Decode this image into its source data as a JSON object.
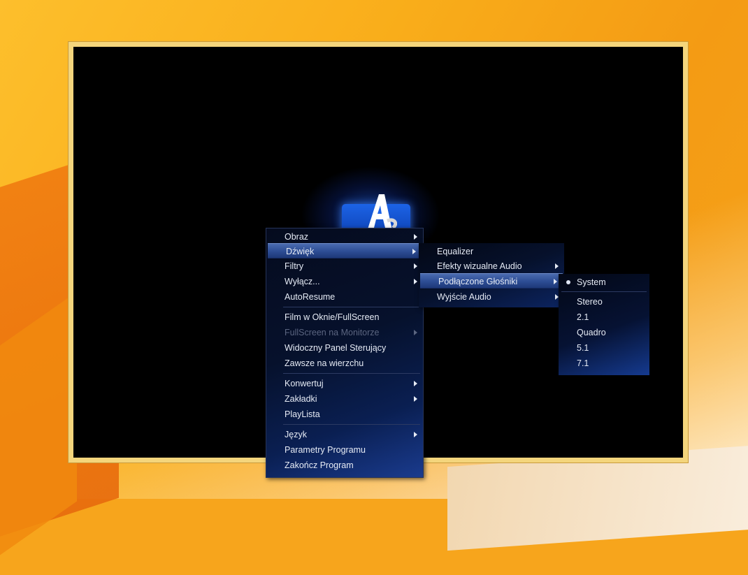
{
  "main_menu": {
    "items": [
      {
        "label": "Obraz",
        "submenu": true,
        "disabled": false,
        "highlighted": false
      },
      {
        "label": "Dźwięk",
        "submenu": true,
        "disabled": false,
        "highlighted": true
      },
      {
        "label": "Filtry",
        "submenu": true,
        "disabled": false,
        "highlighted": false
      },
      {
        "label": "Wyłącz...",
        "submenu": true,
        "disabled": false,
        "highlighted": false
      },
      {
        "label": "AutoResume",
        "submenu": false,
        "disabled": false,
        "highlighted": false
      },
      {
        "label": "Film w Oknie/FullScreen",
        "submenu": false,
        "disabled": false,
        "highlighted": false
      },
      {
        "label": "FullScreen na Monitorze",
        "submenu": true,
        "disabled": true,
        "highlighted": false
      },
      {
        "label": "Widoczny Panel Sterujący",
        "submenu": false,
        "disabled": false,
        "highlighted": false
      },
      {
        "label": "Zawsze na wierzchu",
        "submenu": false,
        "disabled": false,
        "highlighted": false
      },
      {
        "label": "Konwertuj",
        "submenu": true,
        "disabled": false,
        "highlighted": false
      },
      {
        "label": "Zakładki",
        "submenu": true,
        "disabled": false,
        "highlighted": false
      },
      {
        "label": "PlayLista",
        "submenu": false,
        "disabled": false,
        "highlighted": false
      },
      {
        "label": "Język",
        "submenu": true,
        "disabled": false,
        "highlighted": false
      },
      {
        "label": "Parametry Programu",
        "submenu": false,
        "disabled": false,
        "highlighted": false
      },
      {
        "label": "Zakończ Program",
        "submenu": false,
        "disabled": false,
        "highlighted": false
      }
    ]
  },
  "sound_submenu": {
    "items": [
      {
        "label": "Equalizer",
        "submenu": false,
        "highlighted": false
      },
      {
        "label": "Efekty wizualne Audio",
        "submenu": true,
        "highlighted": false
      },
      {
        "label": "Podłączone Głośniki",
        "submenu": true,
        "highlighted": true
      },
      {
        "label": "Wyjście Audio",
        "submenu": true,
        "highlighted": false
      }
    ]
  },
  "speakers_submenu": {
    "items": [
      {
        "label": "System",
        "selected": true
      },
      {
        "label": "Stereo",
        "selected": false
      },
      {
        "label": "2.1",
        "selected": false
      },
      {
        "label": "Quadro",
        "selected": false
      },
      {
        "label": "5.1",
        "selected": false
      },
      {
        "label": "7.1",
        "selected": false
      }
    ]
  },
  "colors": {
    "desktop": "#f7a51c",
    "window_border": "#f4d57c",
    "menu_background": "#06112c",
    "highlight": "#2f4f96"
  },
  "icons": {
    "app_logo": "aimp-logo-icon",
    "submenu_arrow": "chevron-right-icon",
    "radio_selected": "radio-dot-icon"
  }
}
